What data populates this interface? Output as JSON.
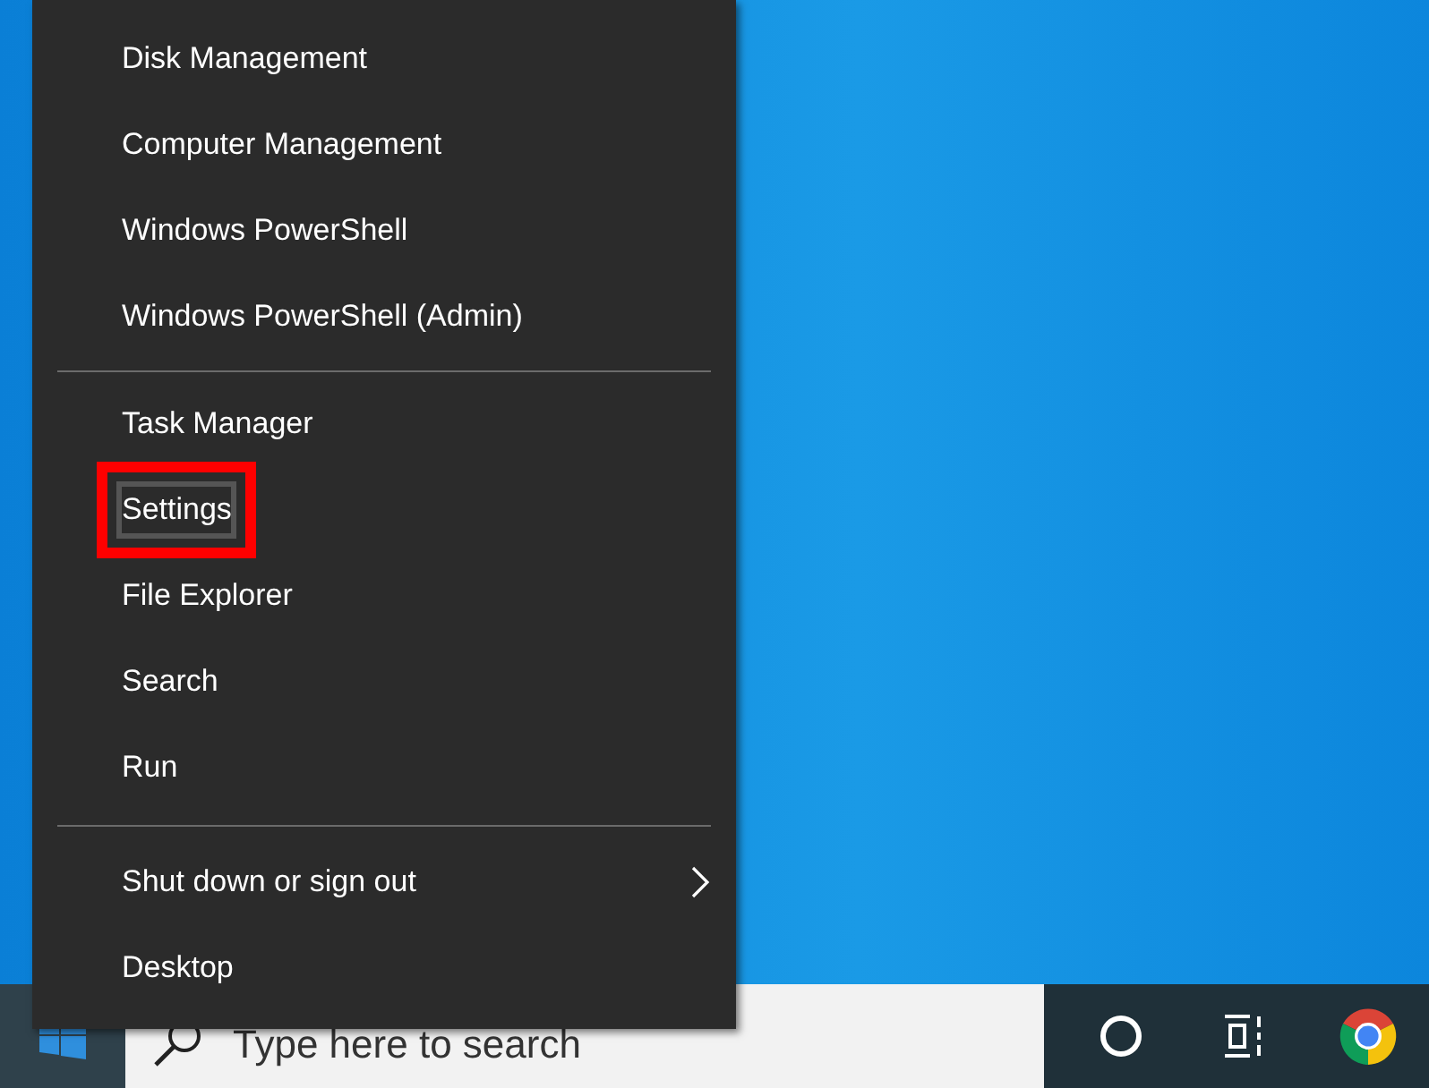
{
  "menu": {
    "groups": [
      {
        "items": [
          {
            "label": "Disk Management",
            "annotated": false,
            "submenu": false
          },
          {
            "label": "Computer Management",
            "annotated": false,
            "submenu": false
          },
          {
            "label": "Windows PowerShell",
            "annotated": false,
            "submenu": false
          },
          {
            "label": "Windows PowerShell (Admin)",
            "annotated": false,
            "submenu": false
          }
        ]
      },
      {
        "items": [
          {
            "label": "Task Manager",
            "annotated": false,
            "submenu": false
          },
          {
            "label": "Settings",
            "annotated": true,
            "submenu": false
          },
          {
            "label": "File Explorer",
            "annotated": false,
            "submenu": false
          },
          {
            "label": "Search",
            "annotated": false,
            "submenu": false
          },
          {
            "label": "Run",
            "annotated": false,
            "submenu": false
          }
        ]
      },
      {
        "items": [
          {
            "label": "Shut down or sign out",
            "annotated": false,
            "submenu": true
          },
          {
            "label": "Desktop",
            "annotated": false,
            "submenu": false
          }
        ]
      }
    ]
  },
  "taskbar": {
    "search": {
      "placeholder": "Type here to search"
    }
  }
}
